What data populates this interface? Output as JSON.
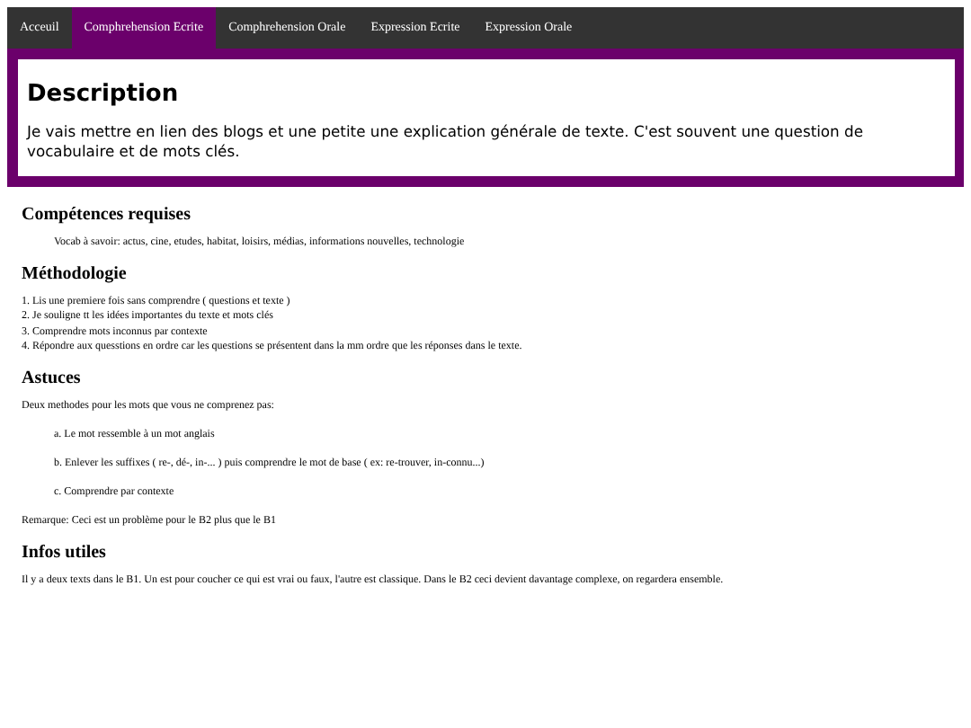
{
  "nav": [
    {
      "label": "Acceuil",
      "selected": false
    },
    {
      "label": "Comphrehension Ecrite",
      "selected": true
    },
    {
      "label": "Comphrehension Orale",
      "selected": false
    },
    {
      "label": "Expression Ecrite",
      "selected": false
    },
    {
      "label": "Expression Orale",
      "selected": false
    }
  ],
  "description": {
    "title": "Description",
    "text": "Je vais mettre en lien des blogs et une petite une explication générale de texte. C'est souvent une question de vocabulaire et de mots clés."
  },
  "sections": [
    {
      "heading": "Compétences requises",
      "blocks": [
        {
          "kind": "indent",
          "text": "Vocab à savoir: actus, cine, etudes, habitat, loisirs, médias, informations nouvelles, technologie"
        }
      ]
    },
    {
      "heading": "Méthodologie",
      "blocks": [
        {
          "kind": "lines",
          "lines": [
            "1. Lis une premiere fois sans comprendre ( questions et texte )",
            "2. Je souligne tt les idées importantes du texte et mots clés",
            "3. Comprendre mots inconnus par contexte",
            "4. Répondre aux quesstions en ordre car les questions se présentent dans la mm ordre que les réponses dans le texte."
          ]
        }
      ]
    },
    {
      "heading": "Astuces",
      "blocks": [
        {
          "kind": "para",
          "text": "Deux methodes pour les mots que vous ne comprenez pas:"
        },
        {
          "kind": "indent",
          "text": "a. Le mot ressemble à un mot anglais"
        },
        {
          "kind": "indent",
          "text": "b. Enlever les suffixes ( re-, dé-, in-... ) puis comprendre le mot de base ( ex: re-trouver, in-connu...)"
        },
        {
          "kind": "indent",
          "text": "c. Comprendre par contexte"
        },
        {
          "kind": "para",
          "text": "Remarque: Ceci est un problème pour le B2 plus que le B1"
        }
      ]
    },
    {
      "heading": "Infos utiles",
      "blocks": [
        {
          "kind": "para",
          "text": "Il y a deux texts dans le B1. Un est pour coucher ce qui est vrai ou faux, l'autre est classique. Dans le B2 ceci devient davantage complexe, on regardera ensemble."
        }
      ]
    }
  ]
}
